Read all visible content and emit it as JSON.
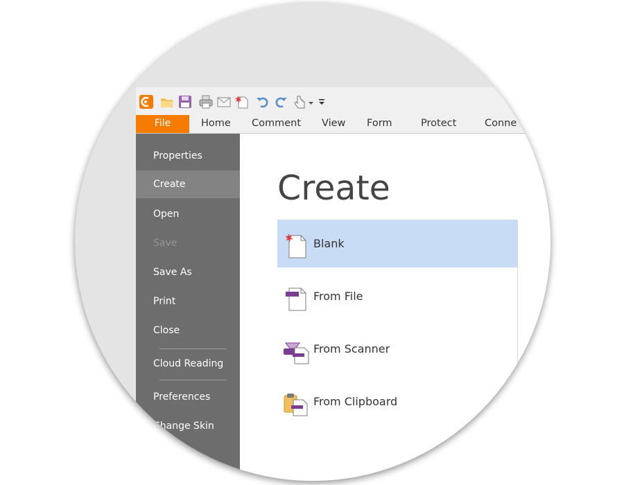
{
  "ribbon": {
    "file_tab": "File",
    "tabs": [
      "Home",
      "Comment",
      "View",
      "Form",
      "Protect",
      "Conne"
    ]
  },
  "sidebar": {
    "items": [
      {
        "label": "Properties"
      },
      {
        "label": "Create"
      },
      {
        "label": "Open"
      },
      {
        "label": "Save"
      },
      {
        "label": "Save As"
      },
      {
        "label": "Print"
      },
      {
        "label": "Close"
      },
      {
        "label": "Cloud Reading"
      },
      {
        "label": "Preferences"
      },
      {
        "label": "Change Skin"
      }
    ],
    "active": "Create",
    "disabled": [
      "Save"
    ]
  },
  "main": {
    "title": "Create",
    "options": [
      {
        "label": "Blank",
        "icon": "blank-document-icon",
        "selected": true
      },
      {
        "label": "From File",
        "icon": "from-file-icon"
      },
      {
        "label": "From Scanner",
        "icon": "scanner-icon"
      },
      {
        "label": "From Clipboard",
        "icon": "clipboard-icon"
      }
    ]
  },
  "colors": {
    "file_tab": "#f57c00",
    "sidebar": "#6d6d6d",
    "sidebar_active": "#838383",
    "selection": "#c9dcf6",
    "accent_purple": "#7b3c94"
  }
}
